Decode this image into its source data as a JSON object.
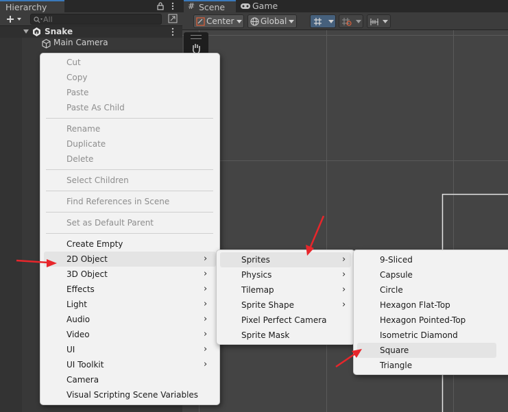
{
  "hierarchy": {
    "tab_label": "Hierarchy",
    "search_placeholder": "All",
    "scene_name": "Snake",
    "items": [
      {
        "label": "Main Camera"
      }
    ]
  },
  "scene_view": {
    "tabs": [
      {
        "label": "Scene"
      },
      {
        "label": "Game"
      }
    ],
    "pivot_mode": "Center",
    "pivot_rotation": "Global"
  },
  "context_menu": {
    "groups": [
      [
        {
          "label": "Cut",
          "enabled": false
        },
        {
          "label": "Copy",
          "enabled": false
        },
        {
          "label": "Paste",
          "enabled": false
        },
        {
          "label": "Paste As Child",
          "enabled": false
        }
      ],
      [
        {
          "label": "Rename",
          "enabled": false
        },
        {
          "label": "Duplicate",
          "enabled": false
        },
        {
          "label": "Delete",
          "enabled": false
        }
      ],
      [
        {
          "label": "Select Children",
          "enabled": false
        }
      ],
      [
        {
          "label": "Find References in Scene",
          "enabled": false
        }
      ],
      [
        {
          "label": "Set as Default Parent",
          "enabled": false
        }
      ],
      [
        {
          "label": "Create Empty"
        },
        {
          "label": "2D Object"
        },
        {
          "label": "3D Object"
        },
        {
          "label": "Effects"
        },
        {
          "label": "Light"
        },
        {
          "label": "Audio"
        },
        {
          "label": "Video"
        },
        {
          "label": "UI"
        },
        {
          "label": "UI Toolkit"
        },
        {
          "label": "Camera"
        },
        {
          "label": "Visual Scripting Scene Variables"
        }
      ]
    ]
  },
  "submenu_2d": [
    {
      "label": "Sprites"
    },
    {
      "label": "Physics"
    },
    {
      "label": "Tilemap"
    },
    {
      "label": "Sprite Shape"
    },
    {
      "label": "Pixel Perfect Camera"
    },
    {
      "label": "Sprite Mask"
    }
  ],
  "submenu_sprites": [
    {
      "label": "9-Sliced"
    },
    {
      "label": "Capsule"
    },
    {
      "label": "Circle"
    },
    {
      "label": "Hexagon Flat-Top"
    },
    {
      "label": "Hexagon Pointed-Top"
    },
    {
      "label": "Isometric Diamond"
    },
    {
      "label": "Square"
    },
    {
      "label": "Triangle"
    }
  ],
  "colors": {
    "annotation_arrow": "#e8262b",
    "selection_tab": "#3a79bb"
  }
}
